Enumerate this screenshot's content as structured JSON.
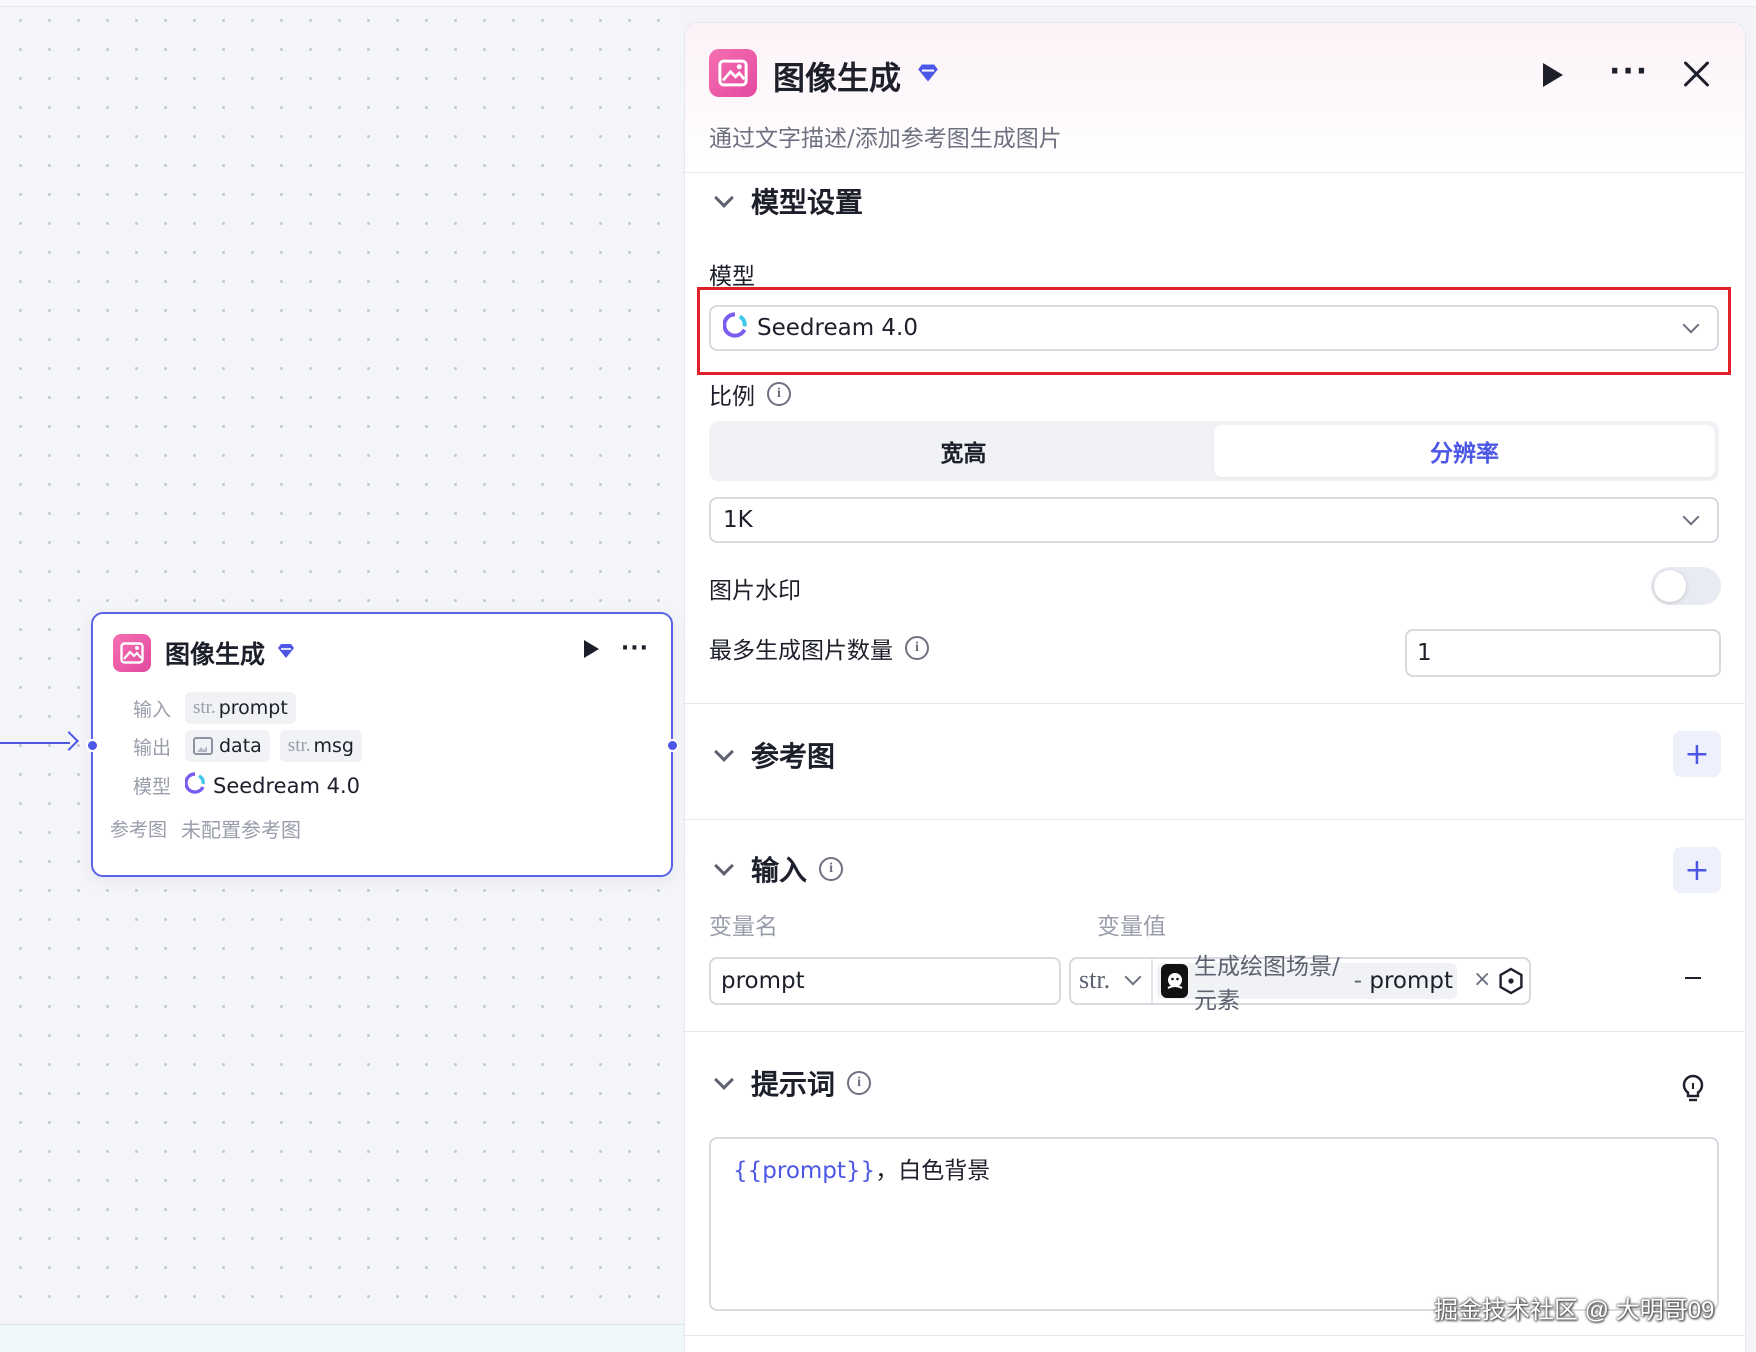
{
  "node": {
    "title": "图像生成",
    "rows": {
      "input_label": "输入",
      "input_type": "str.",
      "input_value": "prompt",
      "output_label": "输出",
      "output_image_value": "data",
      "output_str_type": "str.",
      "output_str_value": "msg",
      "model_label": "模型",
      "model_value": "Seedream 4.0",
      "ref_label": "参考图",
      "ref_value": "未配置参考图"
    },
    "icons": [
      "image-gen-icon",
      "premium-gem-icon",
      "play-icon",
      "more-icon",
      "image-icon",
      "seedream-logo-icon"
    ]
  },
  "panel": {
    "title": "图像生成",
    "description": "通过文字描述/添加参考图生成图片",
    "header_icons": [
      "image-gen-icon",
      "premium-gem-icon",
      "run-icon",
      "more-icon",
      "close-icon"
    ],
    "model_section": {
      "title": "模型设置",
      "model_label": "模型",
      "model_value": "Seedream 4.0",
      "ratio_label": "比例",
      "ratio_tabs": [
        "宽高",
        "分辨率"
      ],
      "ratio_active": "分辨率",
      "resolution_value": "1K",
      "watermark_label": "图片水印",
      "watermark_on": false,
      "max_count_label": "最多生成图片数量",
      "max_count_value": "1"
    },
    "reference_section": {
      "title": "参考图"
    },
    "input_section": {
      "title": "输入",
      "col_name": "变量名",
      "col_value": "变量值",
      "var_name": "prompt",
      "var_type": "str.",
      "ref_source": "生成绘图场景/元素",
      "ref_separator": " - ",
      "ref_var": "prompt",
      "clear_symbol": "×"
    },
    "prompt_section": {
      "title": "提示词",
      "prompt_var": "{{prompt}}",
      "prompt_rest": "，白色背景"
    }
  },
  "colors": {
    "accent": "#4d57e6",
    "highlight_box": "#e0212a",
    "icon_pink": "#f66fb1"
  },
  "watermark": "掘金技术社区 @ 大明哥09"
}
